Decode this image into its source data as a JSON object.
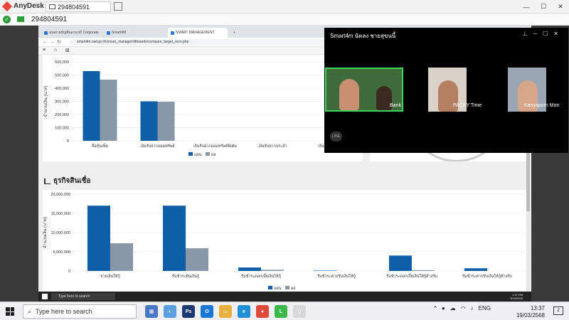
{
  "anydesk": {
    "app_name": "AnyDesk",
    "tab_id": "294804591",
    "session_id": "294804591"
  },
  "browser": {
    "tabs": [
      {
        "label": "คุณยายบัญชีออกแบบี Corporate"
      },
      {
        "label": "Smart4M"
      },
      {
        "label": "SMART MANAGEMENT"
      }
    ],
    "url": "smart4m.cad.go.th/smart_manager/dtboards/compare_target_reco.php"
  },
  "section": {
    "title": "ธุรกิจสินเชื่อ"
  },
  "chart_data": [
    {
      "type": "bar",
      "categories": [
        "ถือหุ้นเพิ่ม",
        "เงินรับฝากออมทรัพย์",
        "เงินรับฝากออมทรัพย์พิเศษ",
        "เงินรับฝากประจำ",
        "เงินรับฝากอื่นๆ"
      ],
      "series": [
        {
          "name": "แผน",
          "values": [
            530000,
            300000,
            0,
            0,
            0
          ]
        },
        {
          "name": "ผล",
          "values": [
            465000,
            297000,
            0,
            0,
            0
          ]
        }
      ],
      "yticks": [
        "0",
        "100,000",
        "200,000",
        "300,000",
        "400,000",
        "500,000",
        "600,000"
      ],
      "ylabel": "จำนวนเงิน (บาท)",
      "ylim": [
        0,
        600000
      ],
      "colors": [
        "#0f5ea8",
        "#8797a8"
      ]
    },
    {
      "type": "bar",
      "categories": [
        "จ่ายเงินให้กู้",
        "รับชำระต้นเงินกู้",
        "รับชำระดอกเบี้ยเงินให้กู้",
        "รับชำระค่าปรับเงินให้กู้",
        "รับชำระดอกเบี้ยเงินให้กู้ค้างรับ",
        "รับชำระค่าปรับเงินให้กู้ค้างรับ"
      ],
      "series": [
        {
          "name": "แผน",
          "values": [
            17000000,
            17000000,
            900000,
            100000,
            4000000,
            700000
          ]
        },
        {
          "name": "ผล",
          "values": [
            7200000,
            5900000,
            300000,
            0,
            200000,
            0
          ]
        }
      ],
      "yticks": [
        "0",
        "5,000,000",
        "10,000,000",
        "15,000,000",
        "20,000,000"
      ],
      "ylabel": "จำนวนเงิน (บาท)",
      "ylim": [
        0,
        20000000
      ],
      "colors": [
        "#0f5ea8",
        "#8797a8"
      ]
    }
  ],
  "legend": {
    "plan": "แผน",
    "result": "ผล"
  },
  "call": {
    "title": "Smart4m นัดลง ชายสุขนนี้",
    "participants": [
      {
        "name": "Bank"
      },
      {
        "name": "PACKY Time"
      },
      {
        "name": "Kanyaporn Mon"
      }
    ],
    "logo_text": "LINE"
  },
  "inner_taskbar": {
    "search_placeholder": "Type here to search",
    "time": "1:37 PM",
    "date": "3/19/2025"
  },
  "taskbar": {
    "search_placeholder": "Type here to search",
    "lang": "ENG",
    "time": "13:37",
    "date": "19/03/2568"
  }
}
